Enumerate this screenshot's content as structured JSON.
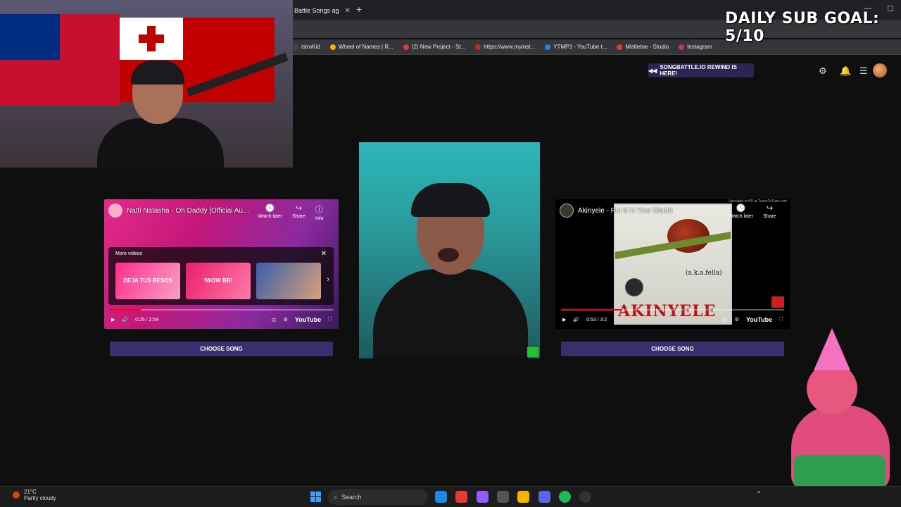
{
  "browser": {
    "active_tab": "Battle Songs ag",
    "bookmarks": [
      {
        "label": "istroKid",
        "color": "#444"
      },
      {
        "label": "Wheel of Names | R...",
        "color": "#f4b400"
      },
      {
        "label": "(2) New Project - St...",
        "color": "#e53935"
      },
      {
        "label": "https://www.myinst...",
        "color": "#c62828"
      },
      {
        "label": "YTMP3 - YouTube t...",
        "color": "#1e88e5"
      },
      {
        "label": "Mistletoe - Studio",
        "color": "#e53935"
      },
      {
        "label": "Instagram",
        "color": "#d62976"
      }
    ]
  },
  "overlay": {
    "sub_goal": "DAILY SUB GOAL: 5/10"
  },
  "header": {
    "rewind_label": "SONGBATTLE.IO REWIND IS HERE!"
  },
  "left_video": {
    "title": "Natti Natasha - Oh Daddy [Official Audio]",
    "watch_later": "Watch later",
    "share": "Share",
    "info": "Info",
    "more_videos": "More videos",
    "thumbs": [
      "DEJA TUS BESOS",
      "!WOW BB!",
      ""
    ],
    "time": "0:25 / 2:59",
    "youtube": "YouTube",
    "progress": 0.14,
    "choose": "CHOOSE SONG"
  },
  "right_video": {
    "title": "Akinyele - Put It In Your Mouth",
    "watch_later": "Watch later",
    "share": "Share",
    "uploaded_note": "Uploaded in HD at TunesToTube.com",
    "album_aka": "(a.k.a.fella)",
    "album_name": "AKINYELE",
    "time": "0:53 / 3:2",
    "youtube": "YouTube",
    "progress": 0.27,
    "choose": "CHOOSE SONG"
  },
  "taskbar": {
    "temperature": "21°C",
    "weather": "Partly cloudy",
    "search_placeholder": "Search"
  }
}
